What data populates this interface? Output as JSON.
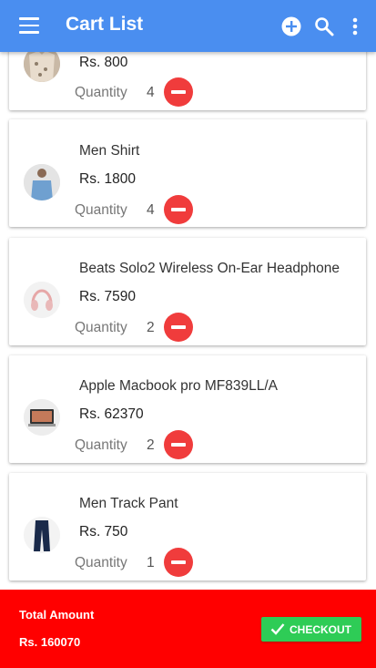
{
  "app_bar": {
    "title": "Cart List",
    "icons": [
      "menu-icon",
      "add-circle-icon",
      "search-icon",
      "more-vert-icon"
    ],
    "color": "#4a8ef0"
  },
  "cart": {
    "quantity_label": "Quantity",
    "items": [
      {
        "name": "",
        "price": "Rs. 800",
        "quantity": "4",
        "thumb": "shirt-image"
      },
      {
        "name": "Men Shirt",
        "price": "Rs. 1800",
        "quantity": "4",
        "thumb": "man-shirt-image"
      },
      {
        "name": "Beats Solo2 Wireless On-Ear Headphone",
        "price": "Rs. 7590",
        "quantity": "2",
        "thumb": "headphone-image"
      },
      {
        "name": "Apple Macbook pro MF839LL/A",
        "price": "Rs. 62370",
        "quantity": "2",
        "thumb": "laptop-image"
      },
      {
        "name": "Men Track Pant",
        "price": "Rs. 750",
        "quantity": "1",
        "thumb": "pant-image"
      }
    ]
  },
  "footer": {
    "total_label": "Total Amount",
    "total_value": "Rs. 160070",
    "checkout_label": "CHECKOUT",
    "color": "#ff0000",
    "checkout_color": "#2ecc56"
  }
}
